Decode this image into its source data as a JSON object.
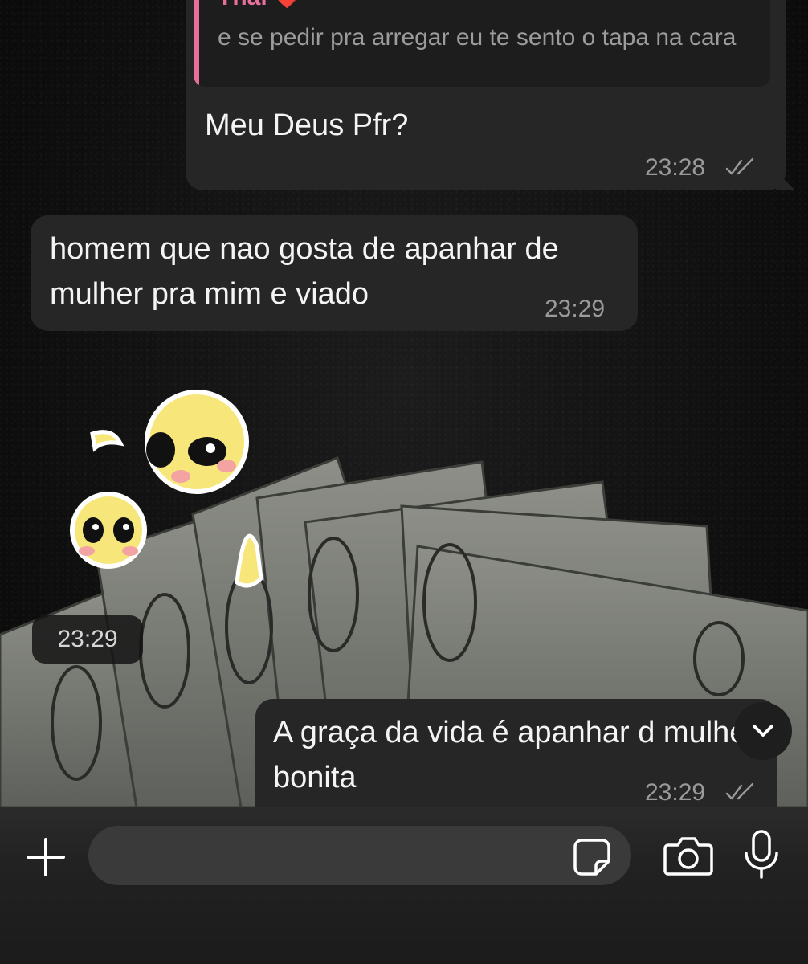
{
  "messages": {
    "reply": {
      "author": "Thai",
      "heart": "❤️",
      "quoted_text": "e se pedir pra arregar eu te sento o tapa na cara",
      "text": "Meu Deus Pfr?",
      "time": "23:28"
    },
    "incoming": {
      "text": "homem que nao gosta de apanhar de mulher pra mim e viado",
      "time": "23:29"
    },
    "sticker": {
      "time": "23:29",
      "description_icon": "money-fan-sticker"
    },
    "outgoing": {
      "text": "A graça da vida é apanhar d mulher bonita",
      "time": "23:29"
    }
  },
  "composer": {
    "placeholder": "",
    "icons": [
      "plus-icon",
      "sticker-icon",
      "camera-icon",
      "mic-icon"
    ]
  },
  "colors": {
    "bubble": "#262626",
    "reply_accent": "#e86f9c",
    "background": "#0d0d0d"
  }
}
